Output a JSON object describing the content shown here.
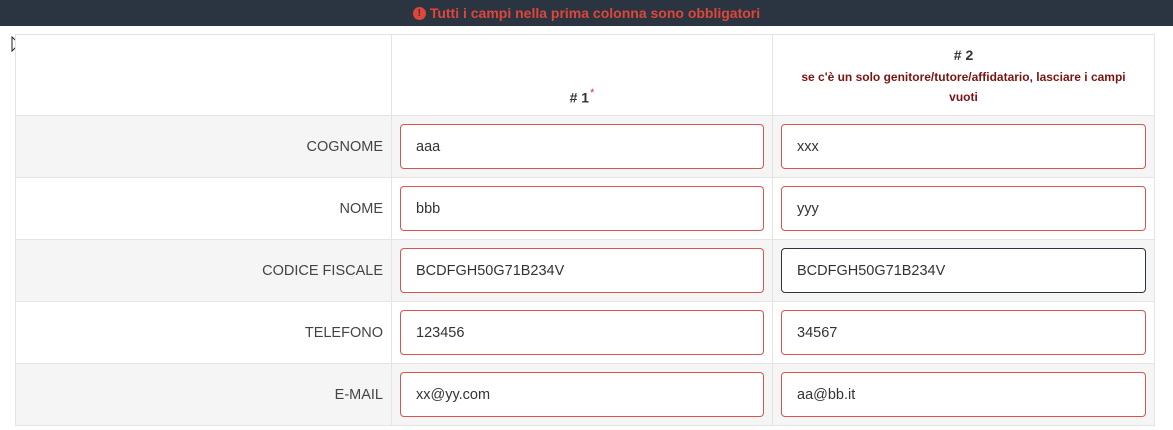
{
  "banner": {
    "icon": "exclamation-circle-icon",
    "message": "Tutti i campi nella prima colonna sono obbligatori"
  },
  "table": {
    "col1_header": "# 1",
    "col1_required_mark": "*",
    "col2_header": "# 2",
    "col2_note": "se c'è un solo genitore/tutore/affidatario, lasciare i campi vuoti",
    "rows": [
      {
        "label": "COGNOME",
        "value1": "aaa",
        "value2": "xxx"
      },
      {
        "label": "NOME",
        "value1": "bbb",
        "value2": "yyy"
      },
      {
        "label": "CODICE FISCALE",
        "value1": "BCDFGH50G71B234V",
        "value2": "BCDFGH50G71B234V"
      },
      {
        "label": "TELEFONO",
        "value1": "123456",
        "value2": "34567"
      },
      {
        "label": "E-MAIL",
        "value1": "xx@yy.com",
        "value2": "aa@bb.it"
      }
    ]
  },
  "colors": {
    "banner_bg": "#2b3541",
    "banner_text": "#e0453a",
    "field_border": "#d9534f",
    "focus_border": "#2b3541"
  }
}
